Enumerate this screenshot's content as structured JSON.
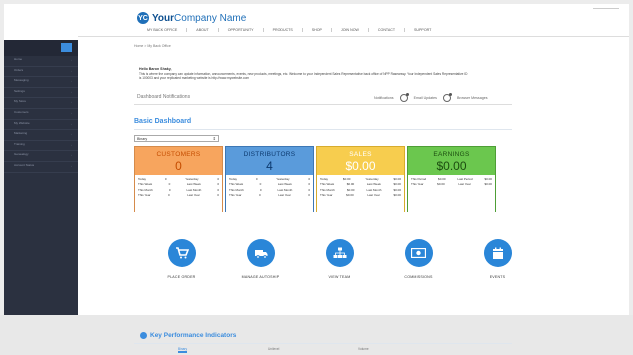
{
  "header": {
    "logo_mark": "YC",
    "logo_strong": "Your",
    "logo_rest": "Company Name",
    "nav": [
      "MY BACK OFFICE",
      "ABOUT",
      "OPPORTUNITY",
      "PRODUCTS",
      "SHOP",
      "JOIN NOW",
      "CONTACT",
      "SUPPORT"
    ]
  },
  "sidebar": {
    "items": [
      "Home",
      "Orders",
      "Messaging",
      "Settings",
      "My Store",
      "Customers",
      "My Website",
      "Marketing",
      "Training",
      "Genealogy",
      "Account Status"
    ]
  },
  "breadcrumb": "Home > My Back Office",
  "greeting": "Hello Baron Shaky,",
  "intro": "This is where the company can update information, announcements, events, new products, meetings, etc. Welcome to your Independent Sales Representative back office of NPP Rasearssy. Your Independent Sales Representative ID is 100003 and your replicated marketing website is http://www.mywebsite.com",
  "notifications": {
    "title": "Dashboard Notifications",
    "label": "Notifications",
    "email_updates": "Email Updates",
    "browser_messages": "Browser Messages"
  },
  "dashboard": {
    "title": "Basic Dashboard",
    "select_value": "Binary",
    "cards": [
      {
        "title": "CUSTOMERS",
        "value": "0",
        "rows": [
          [
            "Today",
            "0",
            "Yesterday",
            "0"
          ],
          [
            "This Week",
            "0",
            "Last Week",
            "0"
          ],
          [
            "This Month",
            "0",
            "Last Month",
            "0"
          ],
          [
            "This Year",
            "0",
            "Last Year",
            "0"
          ]
        ]
      },
      {
        "title": "DISTRIBUTORS",
        "value": "4",
        "rows": [
          [
            "Today",
            "0",
            "Yesterday",
            "0"
          ],
          [
            "This Week",
            "0",
            "Last Week",
            "0"
          ],
          [
            "This Month",
            "0",
            "Last Month",
            "0"
          ],
          [
            "This Year",
            "0",
            "Last Year",
            "0"
          ]
        ]
      },
      {
        "title": "SALES",
        "value": "$0.00",
        "rows": [
          [
            "Today",
            "$0.00",
            "Yesterday",
            "$0.00"
          ],
          [
            "This Week",
            "$0.00",
            "Last Week",
            "$0.00"
          ],
          [
            "This Month",
            "$0.00",
            "Last Month",
            "$0.00"
          ],
          [
            "This Year",
            "$0.00",
            "Last Year",
            "$0.00"
          ]
        ]
      },
      {
        "title": "EARNINGS",
        "value": "$0.00",
        "rows": [
          [
            "This Period",
            "$0.00",
            "Last Period",
            "$0.00"
          ],
          [
            "This Year",
            "$0.00",
            "Last Year",
            "$0.00"
          ]
        ]
      }
    ]
  },
  "actions": [
    "PLACE ORDER",
    "MANAGE AUTOSHIP",
    "VIEW TEAM",
    "COMMISSIONS",
    "EVENTS"
  ],
  "kpi": {
    "title": "Key Performance Indicators",
    "tabs": [
      "Binary",
      "Unilevel",
      "Volume"
    ]
  },
  "colors": {
    "accent": "#3c8dde",
    "customers": "#f7a55e",
    "distributors": "#5a9bdb",
    "sales": "#f7cd4e",
    "earnings": "#6bc74e",
    "sidebar": "#2b3140"
  }
}
